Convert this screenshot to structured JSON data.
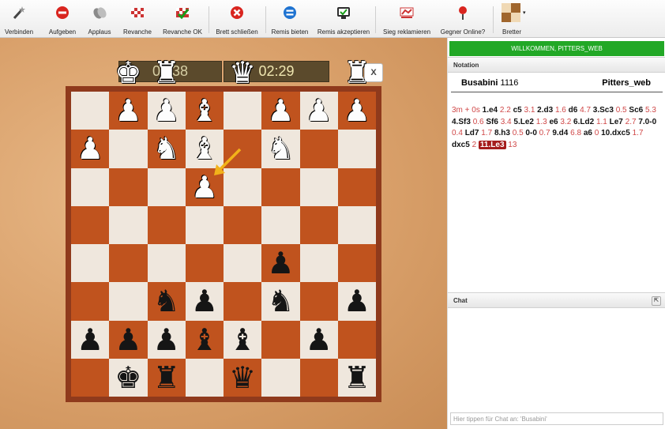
{
  "toolbar": {
    "items": [
      {
        "label": "Verbinden",
        "icon": "wand-icon"
      },
      {
        "label": "Aufgeben",
        "icon": "minus-circle-icon"
      },
      {
        "label": "Applaus",
        "icon": "applause-icon"
      },
      {
        "label": "Revanche",
        "icon": "revanche-icon"
      },
      {
        "label": "Revanche OK",
        "icon": "revanche-ok-icon"
      },
      {
        "label": "Brett schließen",
        "icon": "close-circle-icon"
      },
      {
        "label": "Remis bieten",
        "icon": "equals-circle-icon"
      },
      {
        "label": "Remis akzeptieren",
        "icon": "accept-draw-icon"
      },
      {
        "label": "Sieg reklamieren",
        "icon": "claim-win-icon"
      },
      {
        "label": "Gegner Online?",
        "icon": "pushpin-icon"
      },
      {
        "label": "Bretter",
        "icon": "board-icon"
      }
    ]
  },
  "clocks": {
    "left": "02:38",
    "right": "02:29"
  },
  "close_label": "X",
  "board": {
    "light_color": "#efe7dd",
    "dark_color": "#c0531e",
    "pieces": [
      {
        "c": "w",
        "t": "♚",
        "sq": "b1"
      },
      {
        "c": "w",
        "t": "♜",
        "sq": "c1"
      },
      {
        "c": "w",
        "t": "♛",
        "sq": "e1"
      },
      {
        "c": "w",
        "t": "♜",
        "sq": "h1"
      },
      {
        "c": "w",
        "t": "♟",
        "sq": "b2"
      },
      {
        "c": "w",
        "t": "♟",
        "sq": "c2"
      },
      {
        "c": "w",
        "t": "♝",
        "sq": "d2"
      },
      {
        "c": "w",
        "t": "♟",
        "sq": "f2"
      },
      {
        "c": "w",
        "t": "♟",
        "sq": "g2"
      },
      {
        "c": "w",
        "t": "♟",
        "sq": "h2"
      },
      {
        "c": "w",
        "t": "♟",
        "sq": "a3"
      },
      {
        "c": "w",
        "t": "♞",
        "sq": "c3"
      },
      {
        "c": "w",
        "t": "♝",
        "sq": "d3"
      },
      {
        "c": "w",
        "t": "♞",
        "sq": "f3"
      },
      {
        "c": "w",
        "t": "♟",
        "sq": "d4"
      },
      {
        "c": "b",
        "t": "♟",
        "sq": "f6"
      },
      {
        "c": "b",
        "t": "♞",
        "sq": "c7"
      },
      {
        "c": "b",
        "t": "♟",
        "sq": "d7"
      },
      {
        "c": "b",
        "t": "♞",
        "sq": "f7"
      },
      {
        "c": "b",
        "t": "♟",
        "sq": "h7"
      },
      {
        "c": "b",
        "t": "♟",
        "sq": "a8"
      },
      {
        "c": "b",
        "t": "♟",
        "sq": "b8"
      },
      {
        "c": "b",
        "t": "♟",
        "sq": "c8"
      },
      {
        "c": "b",
        "t": "♝",
        "sq": "d8"
      },
      {
        "c": "b",
        "t": "♝",
        "sq": "e8"
      },
      {
        "c": "b",
        "t": "♟",
        "sq": "g8"
      },
      {
        "c": "b",
        "t": "♚",
        "sq": "b9"
      },
      {
        "c": "b",
        "t": "♜",
        "sq": "c9"
      },
      {
        "c": "b",
        "t": "♛",
        "sq": "e9"
      },
      {
        "c": "b",
        "t": "♜",
        "sq": "h9"
      }
    ],
    "arrow_color": "#f2b21a"
  },
  "welcome": "WILLKOMMEN, PITTERS_WEB",
  "notation": {
    "header": "Notation",
    "white_name": "Busabini",
    "white_rating": "1116",
    "black_name": "Pitters_web",
    "tokens": [
      {
        "k": "t",
        "v": "3m + 0s"
      },
      {
        "k": "m",
        "v": "1.e4"
      },
      {
        "k": "t",
        "v": "2.2"
      },
      {
        "k": "m",
        "v": "c5"
      },
      {
        "k": "t",
        "v": "3.1"
      },
      {
        "k": "m",
        "v": "2.d3"
      },
      {
        "k": "t",
        "v": "1.6"
      },
      {
        "k": "m",
        "v": "d6"
      },
      {
        "k": "t",
        "v": "4.7"
      },
      {
        "k": "m",
        "v": "3.Sc3"
      },
      {
        "k": "t",
        "v": "0.5"
      },
      {
        "k": "m",
        "v": "Sc6"
      },
      {
        "k": "t",
        "v": "5.3"
      },
      {
        "k": "m",
        "v": "4.Sf3"
      },
      {
        "k": "t",
        "v": "0.6"
      },
      {
        "k": "m",
        "v": "Sf6"
      },
      {
        "k": "t",
        "v": "3.4"
      },
      {
        "k": "m",
        "v": "5.Le2"
      },
      {
        "k": "t",
        "v": "1.3"
      },
      {
        "k": "m",
        "v": "e6"
      },
      {
        "k": "t",
        "v": "3.2"
      },
      {
        "k": "m",
        "v": "6.Ld2"
      },
      {
        "k": "t",
        "v": "1.1"
      },
      {
        "k": "m",
        "v": "Le7"
      },
      {
        "k": "t",
        "v": "2.7"
      },
      {
        "k": "m",
        "v": "7.0-0"
      },
      {
        "k": "t",
        "v": "0.4"
      },
      {
        "k": "m",
        "v": "Ld7"
      },
      {
        "k": "t",
        "v": "1.7"
      },
      {
        "k": "m",
        "v": "8.h3"
      },
      {
        "k": "t",
        "v": "0.5"
      },
      {
        "k": "m",
        "v": "0-0"
      },
      {
        "k": "t",
        "v": "0.7"
      },
      {
        "k": "m",
        "v": "9.d4"
      },
      {
        "k": "t",
        "v": "6.8"
      },
      {
        "k": "m",
        "v": "a6"
      },
      {
        "k": "t",
        "v": "0"
      },
      {
        "k": "m",
        "v": "10.dxc5"
      },
      {
        "k": "t",
        "v": "1.7"
      },
      {
        "k": "m",
        "v": "dxc5"
      },
      {
        "k": "t",
        "v": "2"
      },
      {
        "k": "c",
        "v": "11.Le3"
      },
      {
        "k": "t",
        "v": "13"
      }
    ]
  },
  "chat": {
    "header": "Chat",
    "placeholder": "Hier tippen für Chat an: 'Busabini'"
  }
}
